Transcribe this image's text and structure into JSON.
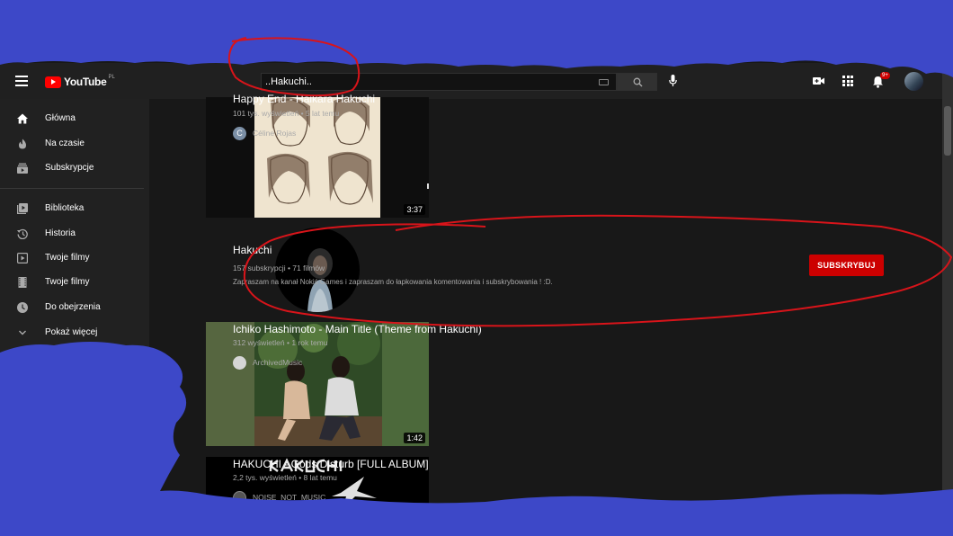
{
  "header": {
    "logo_text": "YouTube",
    "logo_region": "PL",
    "search_value": "..Hakuchi..",
    "notification_count": "9+"
  },
  "sidebar": {
    "items": [
      {
        "label": "Główna",
        "icon": "home-icon"
      },
      {
        "label": "Na czasie",
        "icon": "trending-icon"
      },
      {
        "label": "Subskrypcje",
        "icon": "subscriptions-icon"
      },
      {
        "label": "Biblioteka",
        "icon": "library-icon"
      },
      {
        "label": "Historia",
        "icon": "history-icon"
      },
      {
        "label": "Twoje filmy",
        "icon": "your-videos-icon"
      },
      {
        "label": "Twoje filmy",
        "icon": "movies-icon"
      },
      {
        "label": "Do obejrzenia",
        "icon": "watch-later-icon"
      },
      {
        "label": "Pokaż więcej",
        "icon": "chevron-down-icon"
      }
    ]
  },
  "results": [
    {
      "type": "video",
      "title": "Happy End - Haikara Hakuchi",
      "meta": "101 tys. wyświetleń • 5 lat temu",
      "channel": "Céline Rojas",
      "channel_initial": "C",
      "duration": "3:37"
    },
    {
      "type": "channel",
      "title": "Hakuchi",
      "meta": "157 subskrypcji • 71 filmów",
      "description": "Zapraszam na kanał Nokiś Games i zapraszam do łapkowania komentowania i subskrybowania ! :D.",
      "subscribe_label": "SUBSKRYBUJ"
    },
    {
      "type": "video",
      "title": "Ichiko Hashimoto - Main Title (Theme from Hakuchi)",
      "meta": "312 wyświetleń • 1 rok temu",
      "channel": "ArchivedMusic",
      "duration": "1:42"
    },
    {
      "type": "video",
      "title": "HAKUCHI - Gods Disturb [FULL ALBUM]",
      "meta": "2,2 tys. wyświetleń • 8 lat temu",
      "channel": "NOISE_NOT_MUSIC"
    }
  ],
  "colors": {
    "annotation_blue": "#3d48c8",
    "annotation_red": "#d8141a",
    "subscribe_red": "#cc0000",
    "background": "#181818"
  }
}
